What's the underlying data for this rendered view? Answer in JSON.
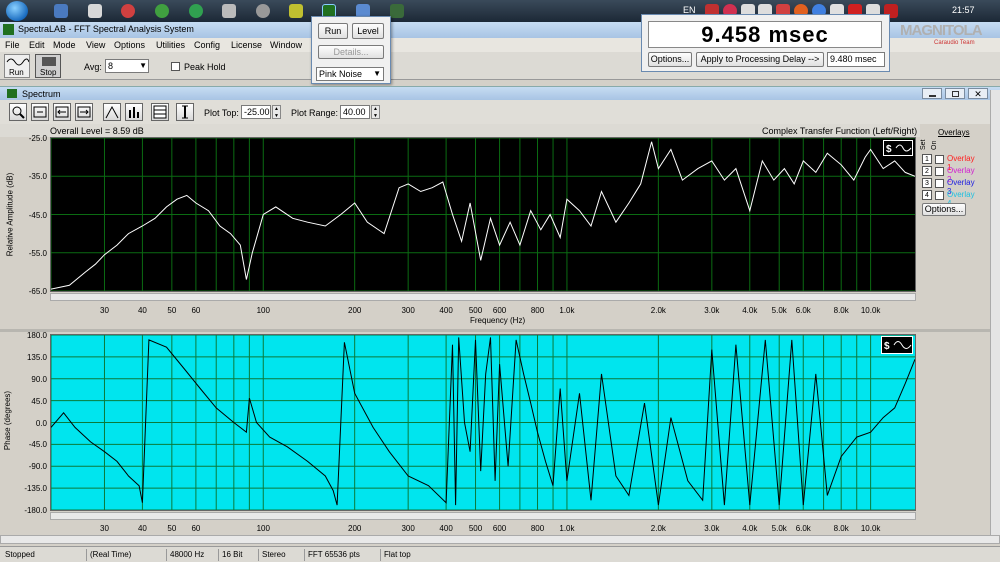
{
  "taskbar": {
    "lang": "EN",
    "clock": "21:57"
  },
  "window": {
    "title": "SpectraLAB - FFT Spectral Analysis System"
  },
  "menu": [
    "File",
    "Edit",
    "Mode",
    "View",
    "Options",
    "Utilities",
    "Config",
    "License",
    "Window"
  ],
  "toolbar": {
    "run_label": "Run",
    "stop_label": "Stop",
    "avg_label": "Avg:",
    "avg_value": "8",
    "peak_hold_label": "Peak Hold"
  },
  "popup": {
    "run_label": "Run",
    "level_label": "Level",
    "details_label": "Details...",
    "noise_value": "Pink Noise"
  },
  "delay": {
    "readout": "9.458 msec",
    "options_label": "Options...",
    "apply_label": "Apply to Processing Delay -->",
    "value": "9.480 msec"
  },
  "watermark": {
    "brand": "MAGNITOLA",
    "sub": "Caraudio Team"
  },
  "spectrum": {
    "title": "Spectrum",
    "plot_top_label": "Plot Top:",
    "plot_top_value": "-25.00",
    "plot_range_label": "Plot Range:",
    "plot_range_value": "40.00",
    "overall_level": "Overall Level = 8.59 dB",
    "function_label": "Complex Transfer Function (Left/Right)",
    "overlays_title": "Overlays",
    "set_label": "Set",
    "on_label": "On",
    "overlays": [
      {
        "num": "1",
        "label": "Overlay 1",
        "color": "#ff2020"
      },
      {
        "num": "2",
        "label": "Overlay 2",
        "color": "#d020d0"
      },
      {
        "num": "3",
        "label": "Overlay 3",
        "color": "#2020e0"
      },
      {
        "num": "4",
        "label": "Overlay 4",
        "color": "#20c0e0"
      }
    ],
    "options_label": "Options..."
  },
  "chart_data": [
    {
      "type": "line",
      "xscale": "log",
      "xlabel": "Frequency (Hz)",
      "ylabel": "Relative Amplitude (dB)",
      "ylim": [
        -65,
        -25
      ],
      "xlim": [
        20,
        14000
      ],
      "yticks": [
        "-25.0",
        "-35.0",
        "-45.0",
        "-55.0",
        "-65.0"
      ],
      "xticks": [
        "30",
        "40",
        "50",
        "60",
        "100",
        "200",
        "300",
        "400",
        "500",
        "600",
        "800",
        "1.0k",
        "2.0k",
        "3.0k",
        "4.0k",
        "5.0k",
        "6.0k",
        "8.0k",
        "10.0k"
      ],
      "xtick_values": [
        30,
        40,
        50,
        60,
        100,
        200,
        300,
        400,
        500,
        600,
        800,
        1000,
        2000,
        3000,
        4000,
        5000,
        6000,
        8000,
        10000
      ],
      "x": [
        20,
        23,
        26,
        28,
        30,
        33,
        36,
        40,
        44,
        48,
        52,
        56,
        60,
        66,
        72,
        78,
        84,
        88,
        92,
        100,
        110,
        125,
        140,
        160,
        180,
        200,
        220,
        250,
        280,
        300,
        330,
        360,
        390,
        420,
        450,
        480,
        520,
        560,
        600,
        650,
        700,
        760,
        820,
        880,
        950,
        1000,
        1100,
        1200,
        1300,
        1450,
        1600,
        1750,
        1900,
        2000,
        2200,
        2400,
        2700,
        3000,
        3300,
        3600,
        4000,
        4400,
        4800,
        5200,
        5600,
        6000,
        6600,
        7200,
        8000,
        8800,
        9600,
        10000,
        11000,
        12000,
        13000,
        14000
      ],
      "y": [
        -64.5,
        -63.5,
        -60,
        -58,
        -55.5,
        -53,
        -50,
        -48,
        -46,
        -43,
        -41,
        -40,
        -42,
        -44,
        -48,
        -50,
        -53,
        -62,
        -55,
        -45,
        -43,
        -46,
        -47,
        -48,
        -45,
        -42,
        -47,
        -50,
        -38,
        -37,
        -39,
        -38,
        -36.5,
        -45,
        -52,
        -42,
        -57,
        -46,
        -53,
        -47,
        -53,
        -44,
        -49,
        -45,
        -51,
        -41,
        -44,
        -48,
        -39,
        -47,
        -42,
        -37,
        -26,
        -33,
        -28,
        -36,
        -33,
        -31,
        -36,
        -33,
        -44,
        -31,
        -36,
        -33,
        -37,
        -31,
        -34,
        -29,
        -32,
        -36,
        -30,
        -28,
        -33,
        -31,
        -34,
        -35
      ]
    },
    {
      "type": "line",
      "xscale": "log",
      "xlabel": "",
      "ylabel": "Phase (degrees)",
      "ylim": [
        -180,
        180
      ],
      "xlim": [
        20,
        14000
      ],
      "yticks": [
        "180.0",
        "135.0",
        "90.0",
        "45.0",
        "0.0",
        "-45.0",
        "-90.0",
        "-135.0",
        "-180.0"
      ],
      "xticks": [
        "30",
        "40",
        "50",
        "60",
        "100",
        "200",
        "300",
        "400",
        "500",
        "600",
        "800",
        "1.0k",
        "2.0k",
        "3.0k",
        "4.0k",
        "5.0k",
        "6.0k",
        "8.0k",
        "10.0k"
      ],
      "xtick_values": [
        30,
        40,
        50,
        60,
        100,
        200,
        300,
        400,
        500,
        600,
        800,
        1000,
        2000,
        3000,
        4000,
        5000,
        6000,
        8000,
        10000
      ],
      "x": [
        20,
        22,
        24,
        27,
        30,
        33,
        36,
        39,
        40,
        42,
        48,
        55,
        62,
        70,
        80,
        88,
        90,
        95,
        105,
        120,
        140,
        160,
        170,
        175,
        185,
        200,
        230,
        260,
        300,
        350,
        400,
        420,
        430,
        440,
        460,
        480,
        500,
        520,
        540,
        560,
        580,
        600,
        640,
        680,
        720,
        760,
        800,
        850,
        900,
        950,
        1000,
        1100,
        1200,
        1300,
        1450,
        1600,
        1800,
        2000,
        2200,
        2500,
        2800,
        3000,
        3300,
        3600,
        4000,
        4500,
        5000,
        5500,
        6000,
        6600,
        7200,
        8000,
        9000,
        10000,
        11000,
        12000,
        13000,
        14000
      ],
      "y": [
        -10,
        20,
        -10,
        -40,
        -60,
        -80,
        -110,
        -130,
        -165,
        170,
        155,
        110,
        70,
        30,
        0,
        -20,
        50,
        0,
        -30,
        -50,
        -80,
        -110,
        -140,
        -170,
        165,
        60,
        -10,
        -60,
        -110,
        -130,
        -165,
        160,
        -170,
        175,
        0,
        -60,
        170,
        -100,
        100,
        175,
        -120,
        120,
        -90,
        170,
        100,
        40,
        -20,
        -80,
        -130,
        70,
        -120,
        60,
        -160,
        100,
        -110,
        -150,
        40,
        -170,
        10,
        -120,
        -160,
        150,
        -170,
        160,
        -170,
        170,
        -170,
        170,
        -170,
        100,
        -150,
        -70,
        -30,
        -20,
        10,
        30,
        80,
        130
      ]
    }
  ],
  "status": {
    "state": "Stopped",
    "mode": "(Real Time)",
    "rate": "48000 Hz",
    "bits": "16 Bit",
    "channels": "Stereo",
    "fft": "FFT 65536 pts",
    "window": "Flat top"
  }
}
